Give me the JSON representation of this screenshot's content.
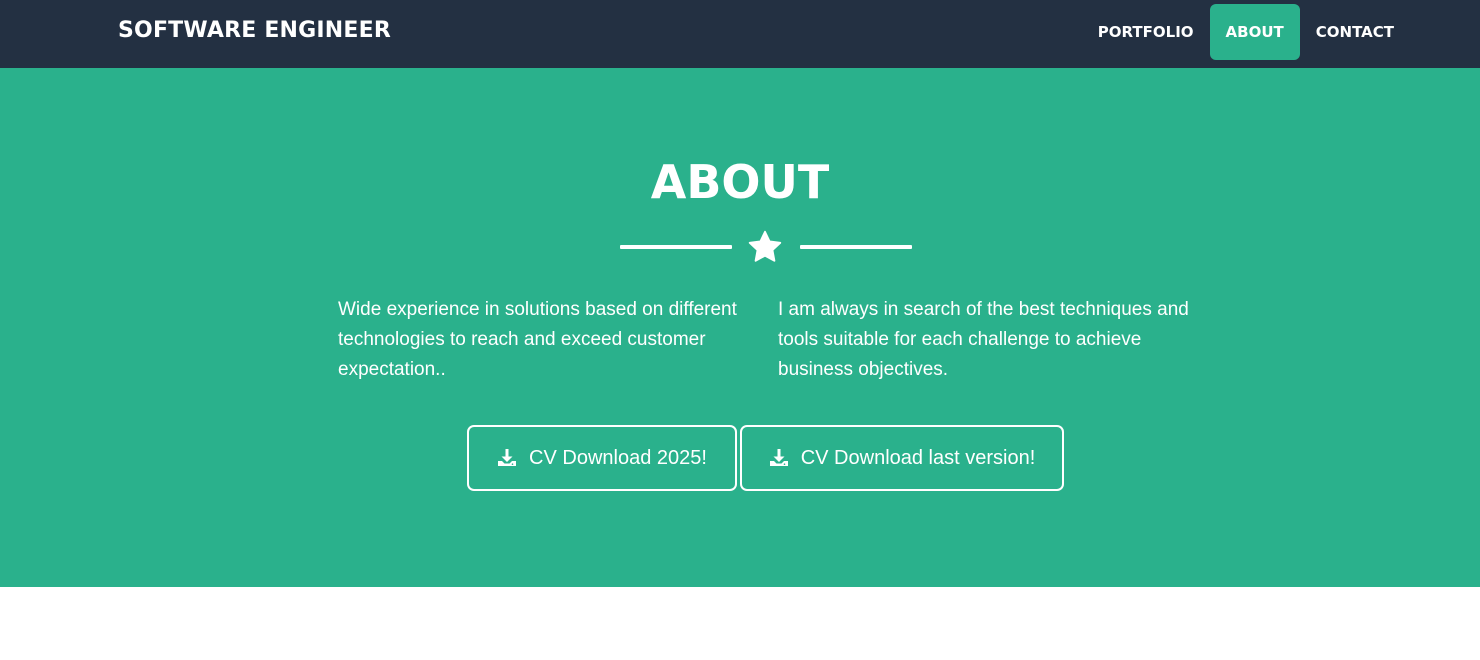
{
  "navbar": {
    "brand": "SOFTWARE ENGINEER",
    "links": [
      {
        "label": "PORTFOLIO",
        "active": false
      },
      {
        "label": "ABOUT",
        "active": true
      },
      {
        "label": "CONTACT",
        "active": false
      }
    ]
  },
  "about": {
    "title": "ABOUT",
    "divider_icon": "star-icon",
    "left_text": "Wide experience in solutions based on different technologies to reach and exceed customer expectation..",
    "right_text": "I am always in search of the best techniques and tools suitable for each challenge to achieve business objectives.",
    "buttons": [
      {
        "label": "CV Download 2025!",
        "icon": "download-icon"
      },
      {
        "label": "CV Download last version!",
        "icon": "download-icon"
      }
    ]
  },
  "colors": {
    "navbar_bg": "#233042",
    "accent": "#2ab18c",
    "text": "#ffffff",
    "page_bg": "#ffffff"
  }
}
